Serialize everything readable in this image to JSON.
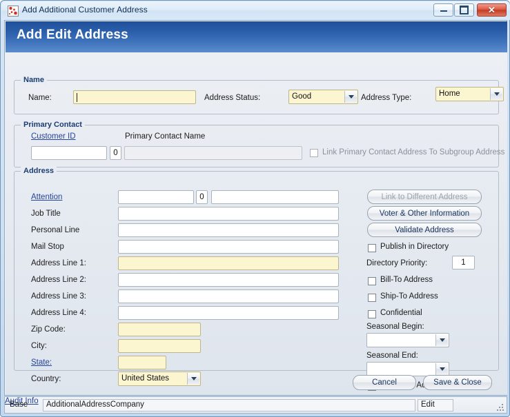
{
  "window": {
    "title": "Add Additional Customer Address",
    "icon": "app-icon",
    "minimize_label": "",
    "maximize_label": "",
    "close_label": "✕"
  },
  "header": {
    "title": "Add Edit Address"
  },
  "name_group": {
    "legend": "Name",
    "name_label": "Name:",
    "name_value": "",
    "address_status_label": "Address Status:",
    "address_status_value": "Good",
    "address_type_label": "Address Type:",
    "address_type_value": "Home"
  },
  "primary_contact_group": {
    "legend": "Primary Contact",
    "customer_id_label": "Customer ID",
    "customer_id_value": "",
    "seq_value": "0",
    "primary_contact_name_label": "Primary Contact Name",
    "primary_contact_name_value": "",
    "link_checkbox_label": "Link Primary Contact Address To Subgroup Address",
    "link_checkbox_checked": false
  },
  "address_group": {
    "legend": "Address",
    "fields": [
      {
        "label": "Attention",
        "link": true,
        "value": "",
        "required": false,
        "kind": "attention"
      },
      {
        "label": "Job Title",
        "link": false,
        "value": "",
        "required": false,
        "kind": "wide"
      },
      {
        "label": "Personal Line",
        "link": false,
        "value": "",
        "required": false,
        "kind": "wide"
      },
      {
        "label": "Mail Stop",
        "link": false,
        "value": "",
        "required": false,
        "kind": "wide"
      },
      {
        "label": "Address Line 1:",
        "link": false,
        "value": "",
        "required": true,
        "kind": "wide"
      },
      {
        "label": "Address Line 2:",
        "link": false,
        "value": "",
        "required": false,
        "kind": "wide"
      },
      {
        "label": "Address Line 3:",
        "link": false,
        "value": "",
        "required": false,
        "kind": "wide"
      },
      {
        "label": "Address Line 4:",
        "link": false,
        "value": "",
        "required": false,
        "kind": "wide"
      },
      {
        "label": "Zip Code:",
        "link": false,
        "value": "",
        "required": true,
        "kind": "medium"
      },
      {
        "label": "City:",
        "link": false,
        "value": "",
        "required": true,
        "kind": "medium"
      },
      {
        "label": "State:",
        "link": true,
        "value": "",
        "required": true,
        "kind": "small"
      }
    ],
    "attention_seq_value": "0",
    "country_label": "Country:",
    "country_value": "United States",
    "buttons": [
      {
        "label": "Link to Different Address",
        "disabled": true
      },
      {
        "label": "Voter & Other Information",
        "disabled": false
      },
      {
        "label": "Validate Address",
        "disabled": false
      }
    ],
    "publish_in_directory_label": "Publish in Directory",
    "publish_in_directory_checked": false,
    "directory_priority_label": "Directory Priority:",
    "directory_priority_value": "1",
    "bill_to_label": "Bill-To Address",
    "bill_to_checked": false,
    "ship_to_label": "Ship-To Address",
    "ship_to_checked": false,
    "confidential_label": "Confidential",
    "confidential_checked": false,
    "seasonal_begin_label": "Seasonal Begin:",
    "seasonal_begin_value": "",
    "seasonal_end_label": "Seasonal End:",
    "seasonal_end_value": "",
    "recurring_label": "Recurring Address",
    "recurring_checked": false
  },
  "actions": {
    "cancel_label": "Cancel",
    "save_close_label": "Save & Close"
  },
  "statusbar": {
    "base_label": "Base",
    "base_value": "AdditionalAddressCompany",
    "edit_label": "Edit",
    "audit_label": "Audit Info"
  },
  "colors": {
    "band_top": "#1f4f9b",
    "band_bottom": "#5b8ccd",
    "required_field": "#fcf6d0",
    "link": "#23449a",
    "legend": "#1c3c74",
    "form_bg": "#e7ebf1"
  }
}
